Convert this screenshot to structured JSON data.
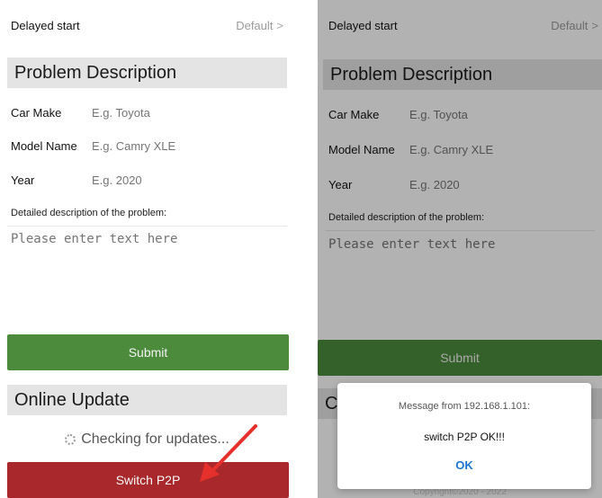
{
  "left": {
    "delayed_start": {
      "label": "Delayed start",
      "value": "Default",
      "chevron": ">"
    },
    "problem_header": "Problem Description",
    "fields": [
      {
        "label": "Car Make",
        "placeholder": "E.g. Toyota"
      },
      {
        "label": "Model Name",
        "placeholder": "E.g. Camry XLE"
      },
      {
        "label": "Year",
        "placeholder": "E.g. 2020"
      }
    ],
    "description_label": "Detailed description of the problem:",
    "description_placeholder": "Please enter text here",
    "submit_label": "Submit",
    "update_header": "Online Update",
    "checking_text": "Checking for updates...",
    "p2p_label": "Switch P2P"
  },
  "right": {
    "delayed_start": {
      "label": "Delayed start",
      "value": "Default",
      "chevron": ">"
    },
    "problem_header": "Problem Description",
    "fields": [
      {
        "label": "Car Make",
        "placeholder": "E.g. Toyota"
      },
      {
        "label": "Model Name",
        "placeholder": "E.g. Camry XLE"
      },
      {
        "label": "Year",
        "placeholder": "E.g. 2020"
      }
    ],
    "description_label": "Detailed description of the problem:",
    "description_placeholder": "Please enter text here",
    "submit_label": "Submit",
    "partial_header": "C",
    "dialog": {
      "title": "Message from 192.168.1.101:",
      "message": "switch P2P OK!!!",
      "ok_label": "OK"
    },
    "copyright": "Copyright©2020 - 2022"
  },
  "colors": {
    "submit_green": "#4b8b3b",
    "p2p_red": "#a8282b",
    "header_gray": "#e4e4e4",
    "ok_blue": "#1976d2",
    "arrow_red": "#e5302b"
  },
  "icons": {
    "spinner": "loading-spinner-icon",
    "arrow": "red-arrow-annotation"
  }
}
